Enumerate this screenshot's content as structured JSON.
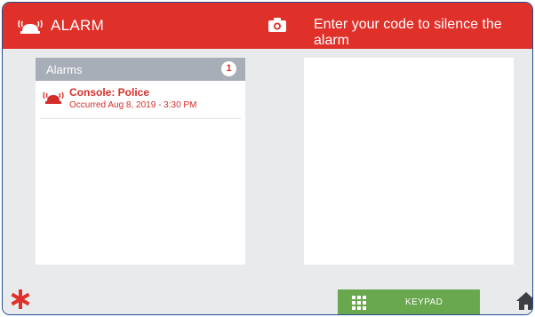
{
  "header": {
    "title": "ALARM",
    "prompt": "Enter your code to silence the alarm",
    "bg_color": "#e0302a"
  },
  "alarms_panel": {
    "title": "Alarms",
    "count": "1",
    "items": [
      {
        "name": "Console: Police",
        "time": "Occurred Aug 8, 2019 - 3:30 PM",
        "icon": "alarm-siren-icon"
      }
    ]
  },
  "footer": {
    "keypad_label": "KEYPAD",
    "keypad_color": "#6aa84f",
    "left_icon": "asterisk-icon",
    "right_icon": "home-icon"
  }
}
